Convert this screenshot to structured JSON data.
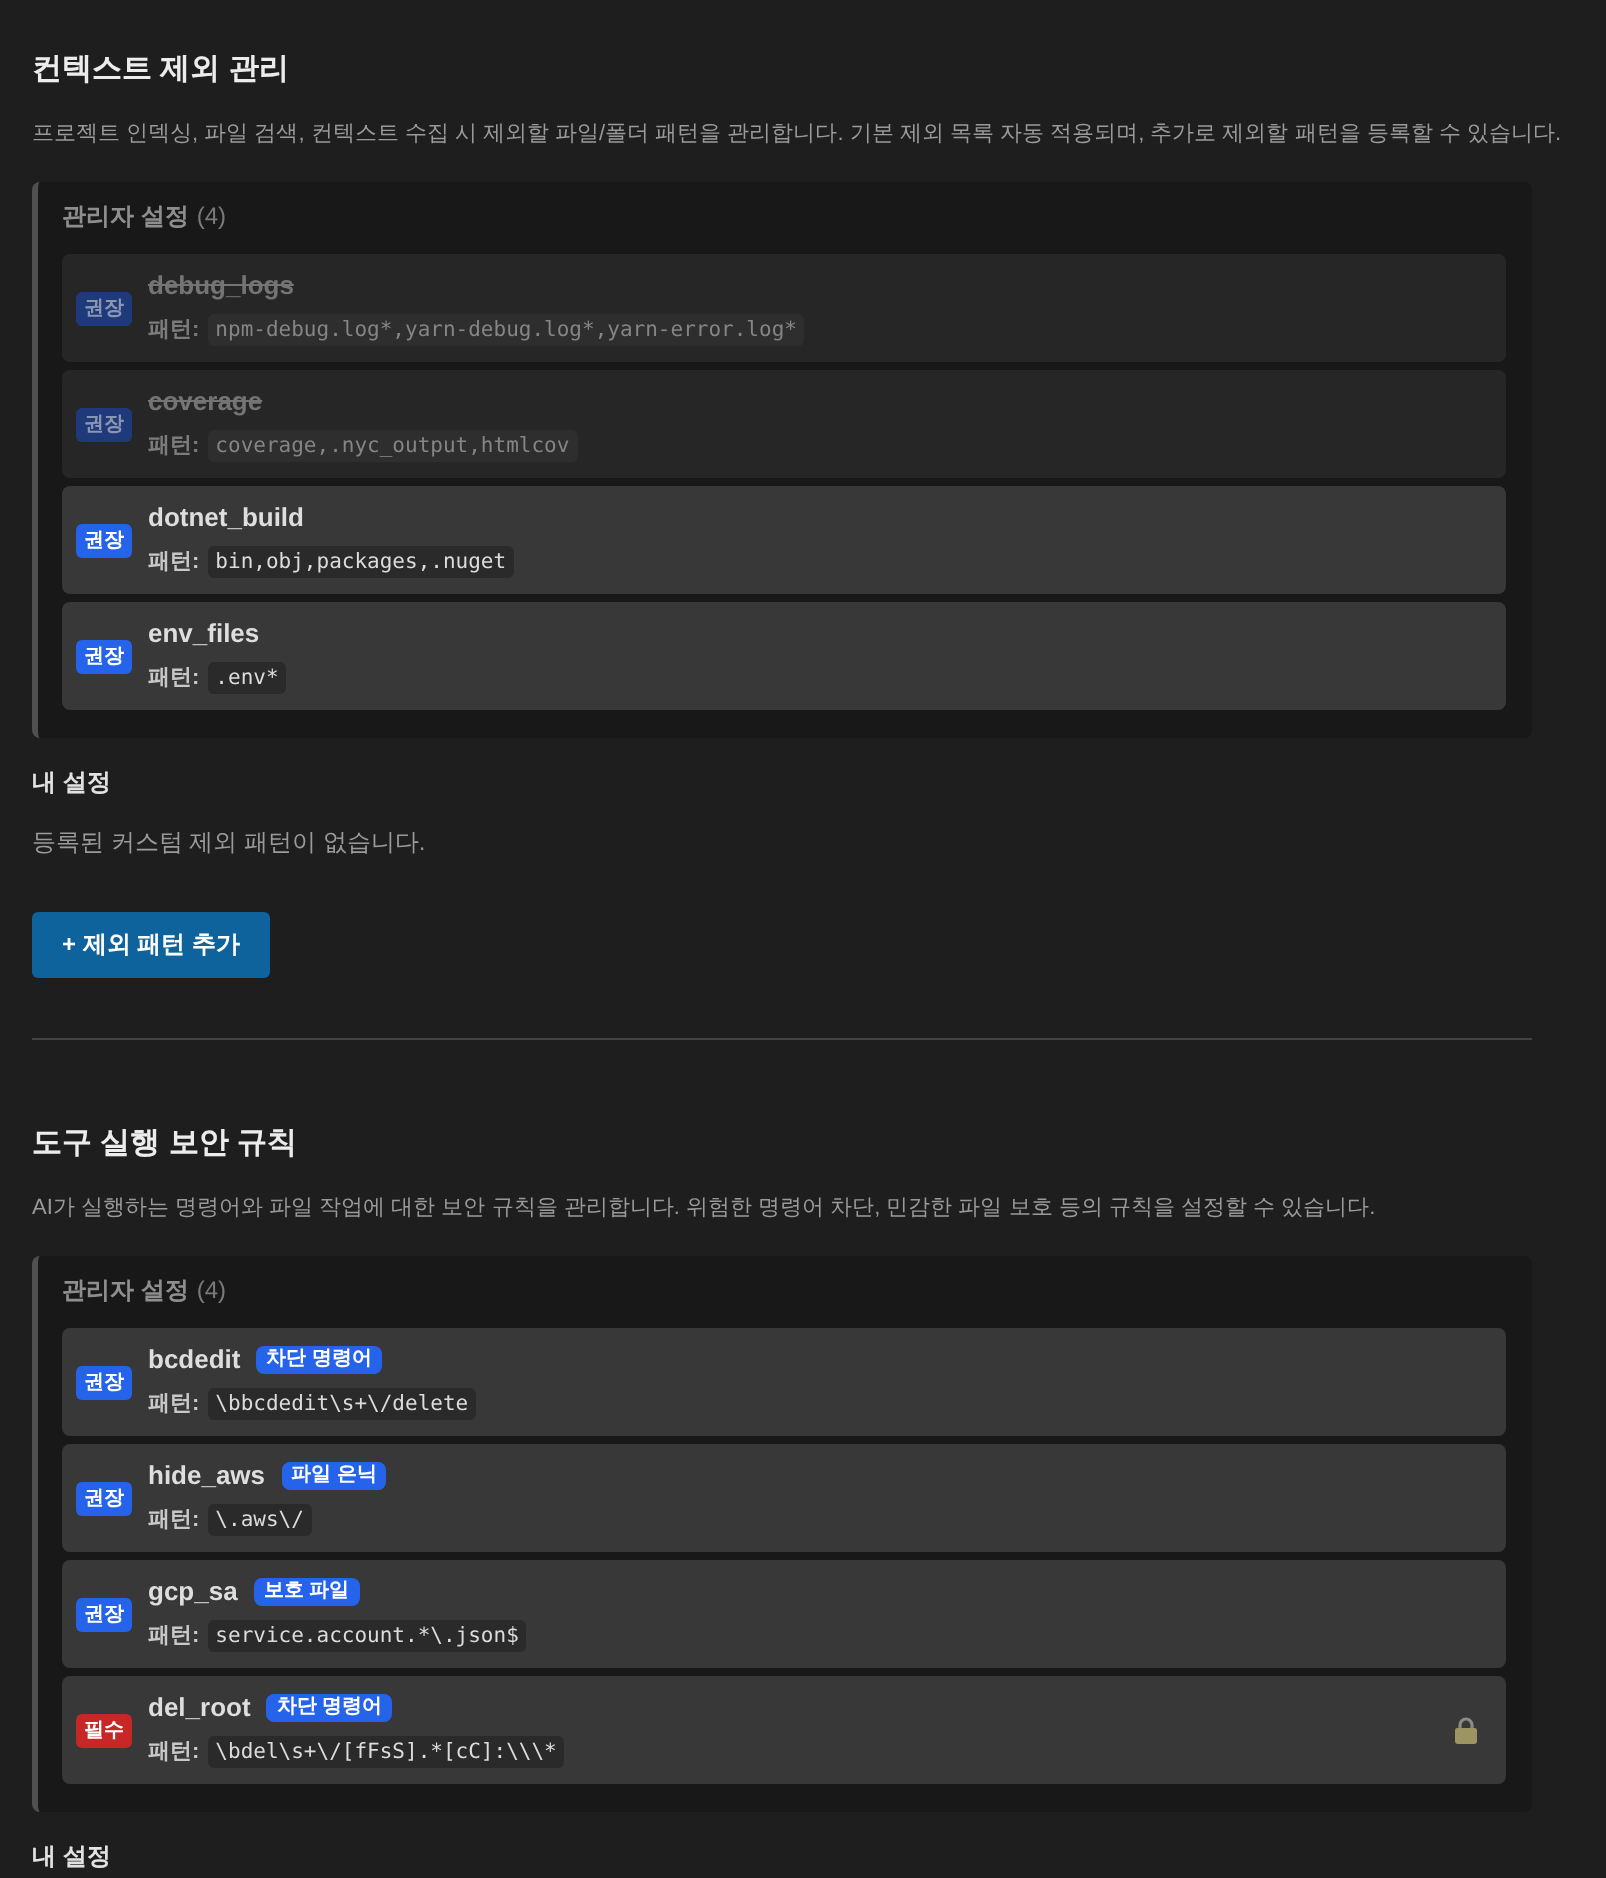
{
  "sections": [
    {
      "title": "컨텍스트 제외 관리",
      "description": "프로젝트 인덱싱, 파일 검색, 컨텍스트 수집 시 제외할 파일/폴더 패턴을 관리합니다. 기본 제외 목록 자동 적용되며, 추가로 제외할 패턴을 등록할 수 있습니다.",
      "admin": {
        "title": "관리자 설정",
        "count": "(4)",
        "items": [
          {
            "badge": {
              "text": "권장",
              "kind": "recommended"
            },
            "name": "debug_logs",
            "pattern_label": "패턴:",
            "pattern": "npm-debug.log*,yarn-debug.log*,yarn-error.log*",
            "enabled": false,
            "locked": false
          },
          {
            "badge": {
              "text": "권장",
              "kind": "recommended"
            },
            "name": "coverage",
            "pattern_label": "패턴:",
            "pattern": "coverage,.nyc_output,htmlcov",
            "enabled": false,
            "locked": false
          },
          {
            "badge": {
              "text": "권장",
              "kind": "recommended"
            },
            "name": "dotnet_build",
            "pattern_label": "패턴:",
            "pattern": "bin,obj,packages,.nuget",
            "enabled": true,
            "locked": false
          },
          {
            "badge": {
              "text": "권장",
              "kind": "recommended"
            },
            "name": "env_files",
            "pattern_label": "패턴:",
            "pattern": ".env*",
            "enabled": true,
            "locked": false
          }
        ]
      },
      "mine": {
        "title": "내 설정",
        "empty_text": "등록된 커스텀 제외 패턴이 없습니다."
      },
      "add_button": "+ 제외 패턴 추가"
    },
    {
      "title": "도구 실행 보안 규칙",
      "description": "AI가 실행하는 명령어와 파일 작업에 대한 보안 규칙을 관리합니다. 위험한 명령어 차단, 민감한 파일 보호 등의 규칙을 설정할 수 있습니다.",
      "admin": {
        "title": "관리자 설정",
        "count": "(4)",
        "items": [
          {
            "badge": {
              "text": "권장",
              "kind": "recommended"
            },
            "name": "bcdedit",
            "tag": "차단 명령어",
            "pattern_label": "패턴:",
            "pattern": "\\bbcdedit\\s+\\/delete",
            "enabled": true,
            "locked": false
          },
          {
            "badge": {
              "text": "권장",
              "kind": "recommended"
            },
            "name": "hide_aws",
            "tag": "파일 은닉",
            "pattern_label": "패턴:",
            "pattern": "\\.aws\\/",
            "enabled": true,
            "locked": false
          },
          {
            "badge": {
              "text": "권장",
              "kind": "recommended"
            },
            "name": "gcp_sa",
            "tag": "보호 파일",
            "pattern_label": "패턴:",
            "pattern": "service.account.*\\.json$",
            "enabled": true,
            "locked": false
          },
          {
            "badge": {
              "text": "필수",
              "kind": "required"
            },
            "name": "del_root",
            "tag": "차단 명령어",
            "pattern_label": "패턴:",
            "pattern": "\\bdel\\s+\\/[fFsS].*[cC]:\\\\\\*",
            "enabled": true,
            "locked": true
          }
        ]
      },
      "mine": {
        "title": "내 설정"
      }
    }
  ]
}
